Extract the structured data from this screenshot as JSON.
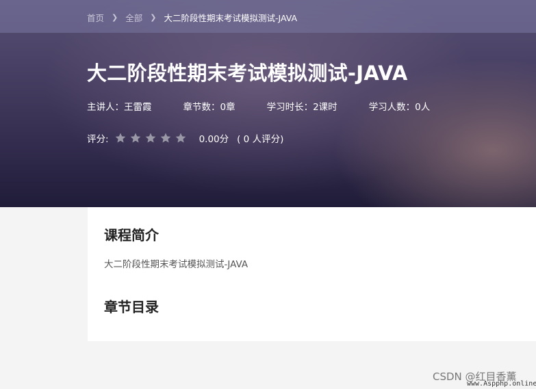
{
  "breadcrumb": {
    "items": [
      "首页",
      "全部",
      "大二阶段性期末考试模拟测试-JAVA"
    ],
    "separator_icon": "chevron-right-icon"
  },
  "course": {
    "title": "大二阶段性期末考试模拟测试-JAVA",
    "meta": {
      "lecturer": "主讲人：王雷霞",
      "chapters": "章节数：0章",
      "duration": "学习时长：2课时",
      "learners": "学习人数：0人"
    },
    "rating": {
      "label": "评分:",
      "stars": 0,
      "max_stars": 5,
      "score": "0.00分",
      "count": "( 0  人评分)"
    }
  },
  "sections": {
    "intro_title": "课程简介",
    "intro_text": "大二阶段性期末考试模拟测试-JAVA",
    "chapter_title": "章节目录"
  },
  "watermark": {
    "text": "CSDN @红目香薰",
    "url": "www.Aspphp.online"
  },
  "colors": {
    "hero_top": "#595174",
    "hero_bottom": "#1f1c38",
    "star_empty": "#9a98a6",
    "card_bg": "#ffffff",
    "page_bg": "#f4f4f4"
  }
}
